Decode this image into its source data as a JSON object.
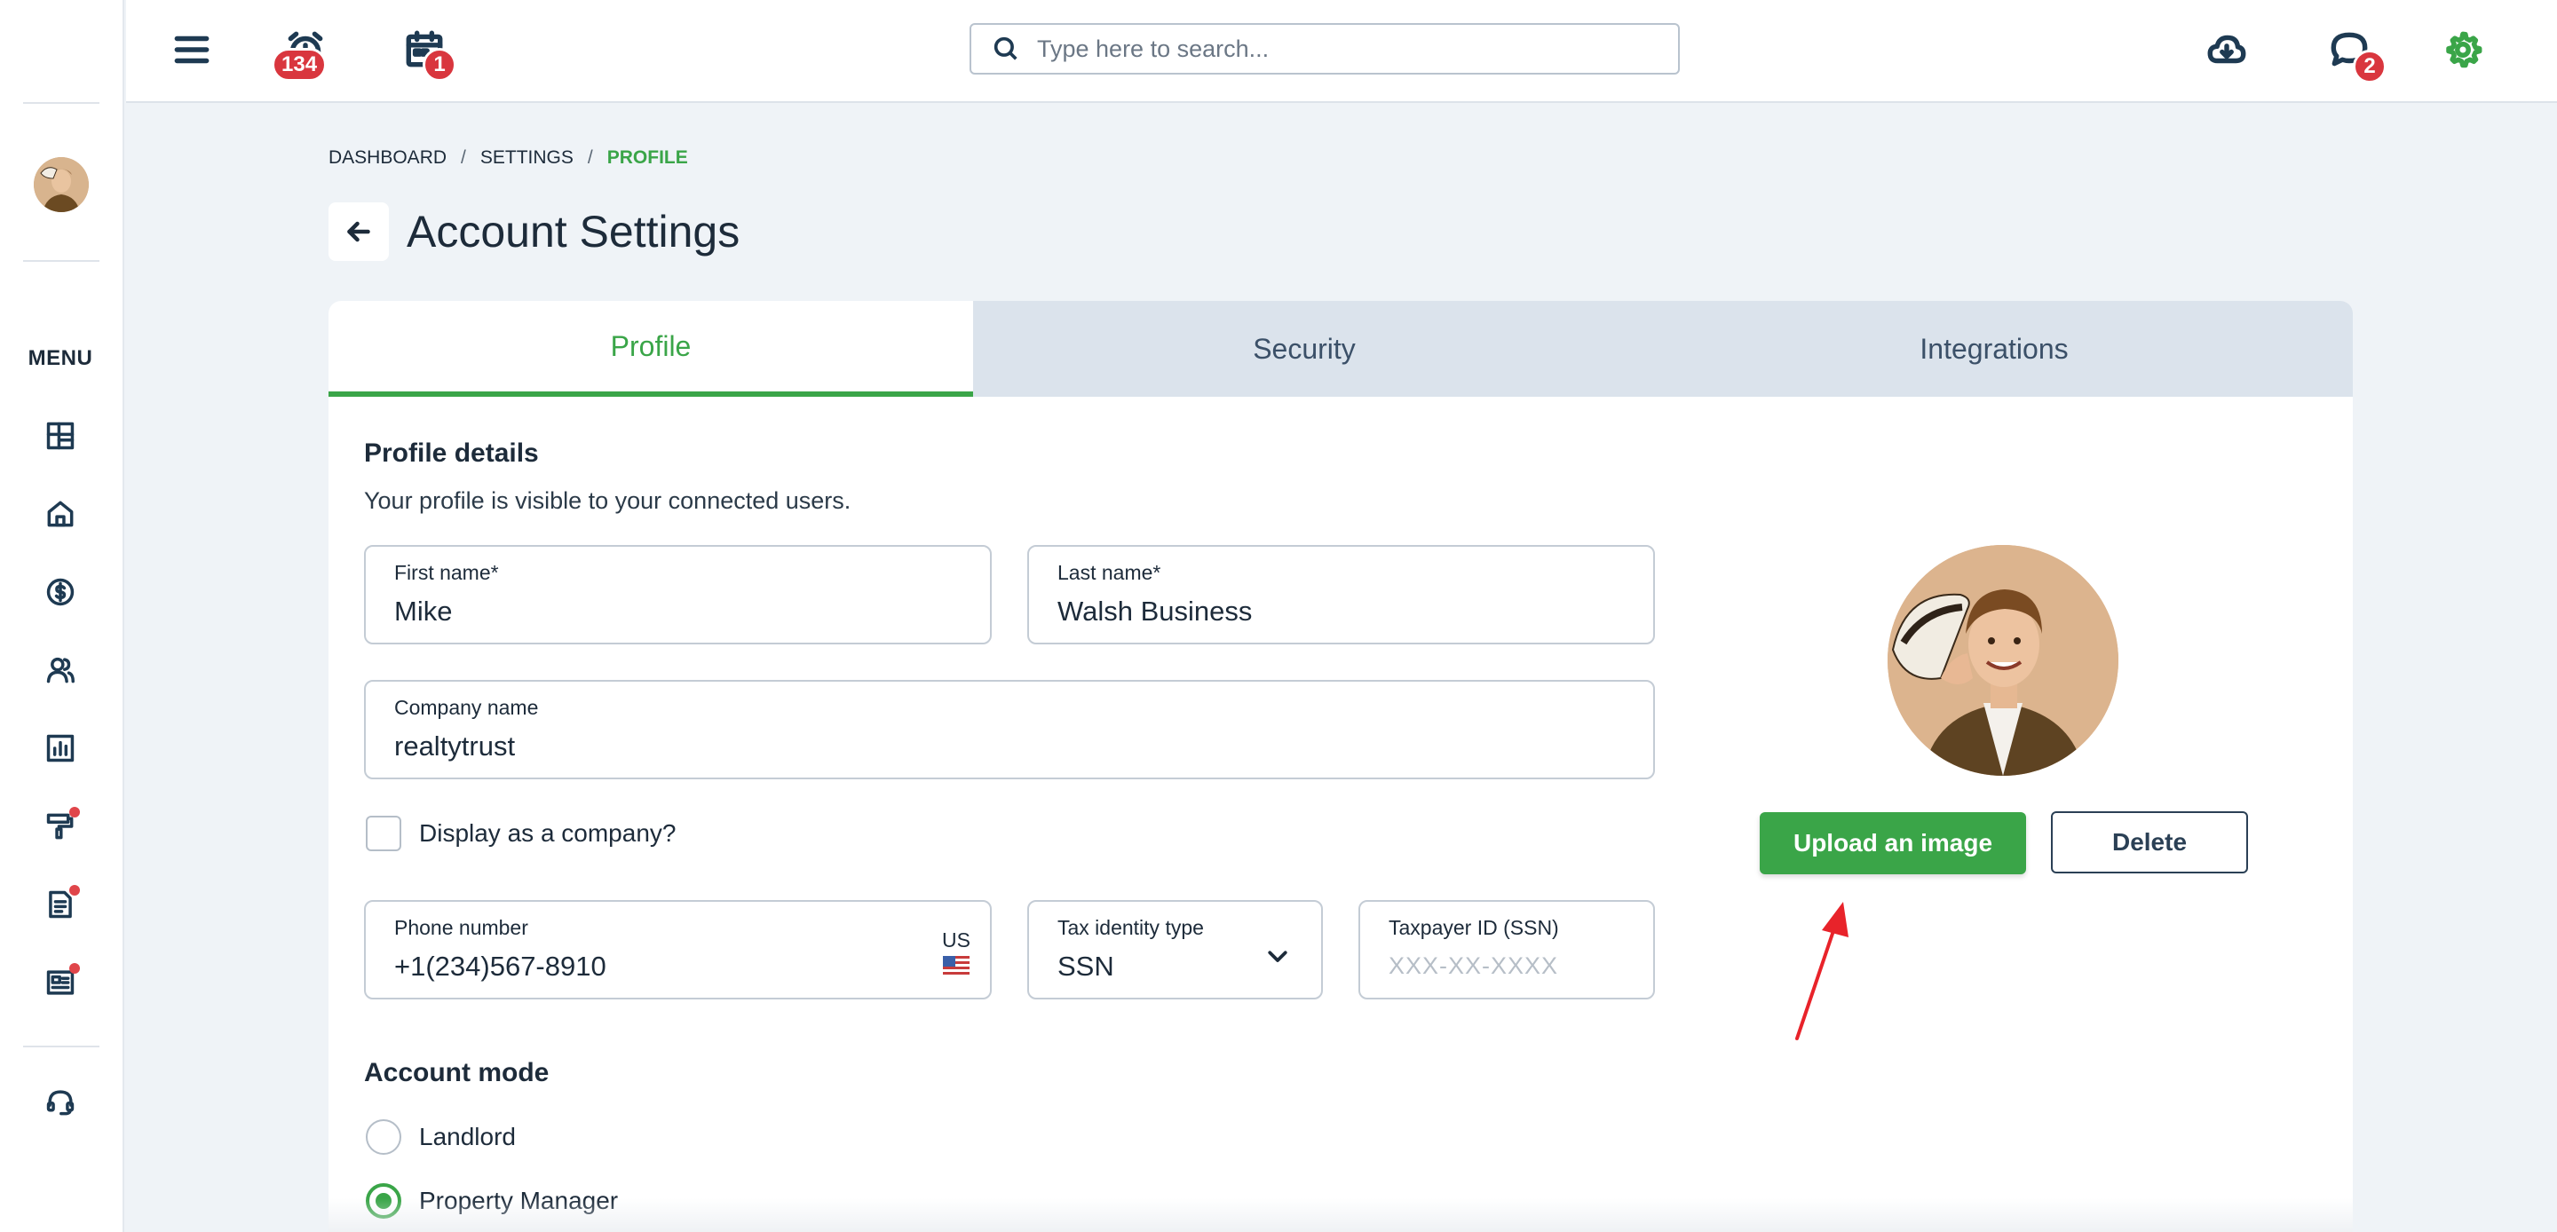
{
  "topbar": {
    "alarm_badge": "134",
    "calendar_badge": "1",
    "search_placeholder": "Type here to search...",
    "messages_badge": "2"
  },
  "sidebar": {
    "menu_label": "MENU",
    "items": [
      {
        "icon": "dashboard-icon",
        "has_dot": false
      },
      {
        "icon": "home-icon",
        "has_dot": false
      },
      {
        "icon": "dollar-icon",
        "has_dot": false
      },
      {
        "icon": "users-icon",
        "has_dot": false
      },
      {
        "icon": "reports-icon",
        "has_dot": false
      },
      {
        "icon": "maintenance-icon",
        "has_dot": true
      },
      {
        "icon": "document-icon",
        "has_dot": true
      },
      {
        "icon": "listing-icon",
        "has_dot": true
      }
    ],
    "support_icon": "headset-icon"
  },
  "breadcrumb": {
    "items": [
      "DASHBOARD",
      "SETTINGS",
      "PROFILE"
    ],
    "separator": "/"
  },
  "page": {
    "title": "Account Settings"
  },
  "tabs": [
    "Profile",
    "Security",
    "Integrations"
  ],
  "profile": {
    "section_title": "Profile details",
    "section_subtitle": "Your profile is visible to your connected users.",
    "first_name_label": "First name*",
    "first_name_value": "Mike",
    "last_name_label": "Last name*",
    "last_name_value": "Walsh Business",
    "company_label": "Company name",
    "company_value": "realtytrust",
    "display_company_label": "Display as a company?",
    "phone_label": "Phone number",
    "phone_value": "+1(234)567-8910",
    "phone_country": "US",
    "tax_type_label": "Tax identity type",
    "tax_type_value": "SSN",
    "taxpayer_label": "Taxpayer ID (SSN)",
    "taxpayer_placeholder": "XXX-XX-XXXX",
    "upload_button": "Upload an image",
    "delete_button": "Delete"
  },
  "account_mode": {
    "title": "Account mode",
    "options": [
      "Landlord",
      "Property Manager"
    ],
    "selected": "Property Manager"
  },
  "colors": {
    "accent": "#3aa548",
    "badge": "#d9363e",
    "annotation_arrow": "#e8232a"
  }
}
